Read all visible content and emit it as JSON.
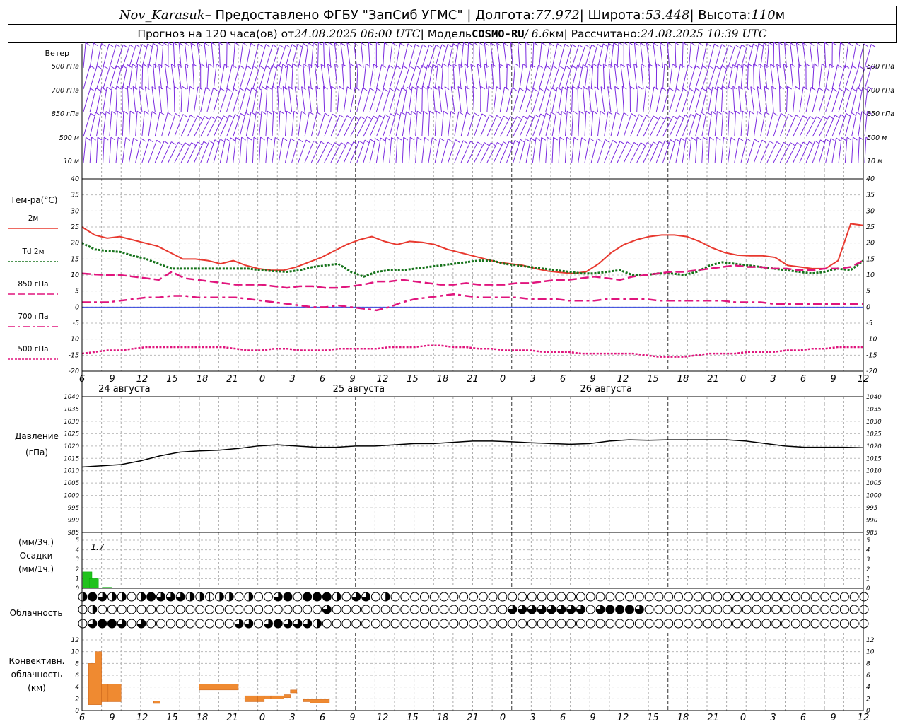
{
  "header": {
    "station": "Nov_Karasuk",
    "provider_label": " – Предоставлено ФГБУ \"ЗапСиб УГМС\" | Долгота: ",
    "longitude": "77.972",
    "lat_label": " | Широта: ",
    "latitude": "53.448",
    "alt_label": " | Высота: ",
    "altitude": "110",
    "alt_unit": "м",
    "forecast_label": "Прогноз на 120 часа(ов) от ",
    "forecast_start": "24.08.2025 06:00 UTC",
    "model_label": " | Модель ",
    "model": "COSMO-RU",
    "model_res": " / 6.6",
    "res_unit": "км",
    "calc_label": " | Рассчитано: ",
    "calc_time": "24.08.2025 10:39 UTC"
  },
  "panels": {
    "wind": {
      "title": "Ветер",
      "levels": [
        "500 гПа",
        "700 гПа",
        "850 гПа",
        "500 м",
        "10   м"
      ]
    },
    "temperature": {
      "title": "Тем-ра(°С)",
      "legend": [
        {
          "label": "2м",
          "color": "#e8392f",
          "style": "solid"
        },
        {
          "label": "Td 2м",
          "color": "#16731b",
          "style": "dotted"
        },
        {
          "label": "850 гПа",
          "color": "#e0157d",
          "style": "longdash"
        },
        {
          "label": "700 гПа",
          "color": "#e0157d",
          "style": "dashdot"
        },
        {
          "label": "500 гПа",
          "color": "#e0157d",
          "style": "dotted"
        }
      ]
    },
    "pressure": {
      "title": "Давление",
      "unit": "(гПа)"
    },
    "precip": {
      "title_top": "(мм/3ч.)",
      "title": "Осадки",
      "title_bottom": "(мм/1ч.)",
      "max_label": "1.7"
    },
    "cloud": {
      "title": "Облачность"
    },
    "convective": {
      "title_1": "Конвективн.",
      "title_2": "облачность",
      "unit": "(км)"
    }
  },
  "time_axis": {
    "hour_labels": [
      "6",
      "9",
      "12",
      "15",
      "18",
      "21",
      "0",
      "3",
      "6",
      "9",
      "12",
      "15",
      "18",
      "21",
      "0",
      "3",
      "6",
      "9",
      "12",
      "15",
      "18",
      "21",
      "0",
      "3",
      "6",
      "9",
      "12"
    ],
    "day_labels": [
      "24 августа",
      "25 августа",
      "26 августа"
    ]
  },
  "chart_data": [
    {
      "type": "line",
      "title": "Тем-ра(°С)",
      "x_hours_from_start": [
        0,
        1,
        3,
        4,
        6,
        8,
        10,
        12,
        14,
        16,
        18,
        20,
        22,
        24,
        26,
        28,
        30,
        32,
        34,
        36,
        38,
        40,
        42,
        44,
        46,
        48,
        50,
        52,
        54,
        56,
        58,
        60,
        62,
        64,
        66,
        68,
        70,
        72,
        74,
        76,
        78,
        80,
        82,
        84,
        86,
        88,
        90,
        92,
        94,
        96,
        98,
        100,
        102,
        104,
        106,
        108,
        110,
        112,
        114,
        116,
        118,
        120
      ],
      "ylim": [
        -20,
        40
      ],
      "series": [
        {
          "name": "2м",
          "values": [
            25,
            22.5,
            21.5,
            22,
            21,
            20,
            19,
            17,
            15,
            15,
            14.5,
            13.5,
            14.5,
            13,
            12,
            11.5,
            11.5,
            12.5,
            14,
            15.5,
            17.5,
            19.5,
            21,
            22,
            20.5,
            19.5,
            20.5,
            20.2,
            19.5,
            18,
            17,
            16,
            15,
            14,
            13.5,
            13,
            12,
            11.2,
            10.8,
            10.5,
            11,
            13.5,
            17,
            19.5,
            21,
            22,
            22.5,
            22.5,
            22,
            20.5,
            18.5,
            17,
            16.2,
            16,
            16,
            15.5,
            13,
            12.5,
            12,
            12,
            14.5,
            26,
            25.5
          ]
        },
        {
          "name": "Td 2м",
          "values": [
            20,
            18,
            17.5,
            17.2,
            16,
            15,
            13.5,
            12,
            12,
            12,
            12,
            12,
            12,
            12,
            11.5,
            11.2,
            11,
            11.5,
            12.5,
            13,
            13.5,
            11,
            9.5,
            11,
            11.5,
            11.5,
            12,
            12.5,
            13,
            13.5,
            14,
            14.5,
            14.5,
            13.5,
            13,
            12.5,
            12,
            11.5,
            11,
            10.5,
            10.5,
            11,
            11.5,
            10,
            10,
            10.5,
            10.5,
            10,
            11,
            13,
            14,
            13.5,
            13,
            12.5,
            12,
            11.5,
            11,
            10.5,
            11,
            12,
            11.5,
            14.5
          ]
        },
        {
          "name": "850 гПа",
          "values": [
            10.5,
            10.2,
            10,
            10,
            9.5,
            9,
            8.5,
            11,
            9,
            8.5,
            8,
            7.5,
            7,
            7,
            7,
            6.5,
            6,
            6.5,
            6.5,
            6,
            6,
            6.5,
            7,
            8,
            8,
            8.5,
            8,
            7.5,
            7,
            7,
            7.5,
            7,
            7,
            7,
            7.5,
            7.5,
            8,
            8.5,
            8.5,
            9,
            9.5,
            9,
            8.5,
            9.5,
            10,
            10.5,
            11,
            11,
            11.5,
            12,
            12.5,
            13,
            12.5,
            12.5,
            12,
            12,
            11.5,
            11.5,
            12,
            12,
            12.5,
            14.5
          ]
        },
        {
          "name": "700 гПа",
          "values": [
            1.5,
            1.5,
            1.5,
            2,
            2.5,
            3,
            3,
            3.5,
            3.5,
            3,
            3,
            3,
            3,
            2.5,
            2,
            1.5,
            1,
            0.5,
            0,
            0,
            0.5,
            0,
            -0.5,
            -1,
            0,
            1.5,
            2.5,
            3,
            3.5,
            4,
            3.5,
            3,
            3,
            3,
            3,
            2.5,
            2.5,
            2.5,
            2,
            2,
            2,
            2.5,
            2.5,
            2.5,
            2.5,
            2,
            2,
            2,
            2,
            2,
            2,
            1.5,
            1.5,
            1.5,
            1,
            1,
            1,
            1,
            1,
            1,
            1,
            1
          ]
        },
        {
          "name": "500 гПа",
          "values": [
            -14.5,
            -14,
            -13.5,
            -13.5,
            -13,
            -12.5,
            -12.5,
            -12.5,
            -12.5,
            -12.5,
            -12.5,
            -12.5,
            -13,
            -13.5,
            -13.5,
            -13,
            -13,
            -13.5,
            -13.5,
            -13.5,
            -13,
            -13,
            -13,
            -13,
            -12.5,
            -12.5,
            -12.5,
            -12,
            -12,
            -12.5,
            -12.5,
            -13,
            -13,
            -13.5,
            -13.5,
            -13.5,
            -14,
            -14,
            -14,
            -14.5,
            -14.5,
            -14.5,
            -14.5,
            -14.5,
            -15,
            -15.5,
            -15.5,
            -15.5,
            -15,
            -14.5,
            -14.5,
            -14.5,
            -14,
            -14,
            -14,
            -13.5,
            -13.5,
            -13,
            -13,
            -12.5,
            -12.5,
            -12.5
          ]
        }
      ]
    },
    {
      "type": "line",
      "title": "Давление",
      "ylabel": "(гПа)",
      "ylim": [
        985,
        1040
      ],
      "x_hours_from_start": [
        0,
        3,
        6,
        9,
        12,
        15,
        18,
        21,
        24,
        27,
        30,
        33,
        36,
        39,
        42,
        45,
        48,
        51,
        54,
        57,
        60,
        63,
        66,
        69,
        72,
        75,
        78,
        81,
        84,
        87,
        90,
        93,
        96,
        99,
        102,
        105,
        108,
        111,
        114,
        117,
        120
      ],
      "series": [
        {
          "name": "Давление",
          "values": [
            1011.5,
            1012,
            1012.5,
            1014,
            1016,
            1017.5,
            1018,
            1018.3,
            1019,
            1020,
            1020.5,
            1020,
            1019.5,
            1019.5,
            1020,
            1020,
            1020.5,
            1021,
            1021,
            1021.5,
            1022,
            1022,
            1021.7,
            1021.3,
            1021,
            1020.7,
            1021,
            1022,
            1022.5,
            1022.3,
            1022.5,
            1022.5,
            1022.5,
            1022.5,
            1022,
            1021,
            1020,
            1019.5,
            1019.5,
            1019.5,
            1019.3
          ]
        }
      ]
    },
    {
      "type": "bar",
      "title": "Осадки",
      "ylabel": "(мм/3ч.) (мм/1ч.)",
      "ylim": [
        0,
        5
      ],
      "x_hours_from_start": [
        0,
        1,
        3
      ],
      "values": [
        1.7,
        1.0,
        0.1
      ]
    },
    {
      "type": "bar",
      "title": "Конвективн. облачность",
      "ylabel": "(км)",
      "ylim": [
        0,
        12
      ],
      "segments": [
        {
          "x_start": 1,
          "x_end": 2,
          "base": 1.0,
          "top": 8.0
        },
        {
          "x_start": 2,
          "x_end": 3,
          "base": 1.0,
          "top": 10.0
        },
        {
          "x_start": 3,
          "x_end": 4,
          "base": 1.5,
          "top": 4.5
        },
        {
          "x_start": 4,
          "x_end": 6,
          "base": 1.5,
          "top": 4.5
        },
        {
          "x_start": 11,
          "x_end": 12,
          "base": 1.2,
          "top": 1.6
        },
        {
          "x_start": 18,
          "x_end": 19,
          "base": 4.0,
          "top": 4.5
        },
        {
          "x_start": 18,
          "x_end": 24,
          "base": 3.5,
          "top": 4.5
        },
        {
          "x_start": 25,
          "x_end": 27,
          "base": 1.5,
          "top": 2.5
        },
        {
          "x_start": 27,
          "x_end": 28,
          "base": 1.5,
          "top": 2.5
        },
        {
          "x_start": 28,
          "x_end": 29,
          "base": 2.0,
          "top": 2.5
        },
        {
          "x_start": 29,
          "x_end": 31,
          "base": 2.0,
          "top": 2.5
        },
        {
          "x_start": 31,
          "x_end": 32,
          "base": 2.2,
          "top": 2.7
        },
        {
          "x_start": 32,
          "x_end": 33,
          "base": 3.0,
          "top": 3.5
        },
        {
          "x_start": 34,
          "x_end": 35,
          "base": 1.5,
          "top": 1.9
        },
        {
          "x_start": 35,
          "x_end": 38,
          "base": 1.3,
          "top": 1.9
        }
      ]
    }
  ],
  "cloud_rows": [
    "24322024333221220200340444203302000000000000000000000000000000000000000000000000000000000000000000000000000000000000000",
    "02000000000000000000000003000000000000000000333333330344430000000000000000000000000000000000000000000000000000000000",
    "03443030000000003303433320000000000000000000000000000000000000000000000000000000000000000000000000000000000000000000"
  ],
  "colors": {
    "temp_2m": "#e8392f",
    "dewpoint": "#16731b",
    "upper": "#e0157d",
    "wind": "#7a2ae0",
    "pressure": "#000000",
    "precip": "#21c21d",
    "convective": "#ef8a31",
    "zero_line": "#3344dd"
  }
}
